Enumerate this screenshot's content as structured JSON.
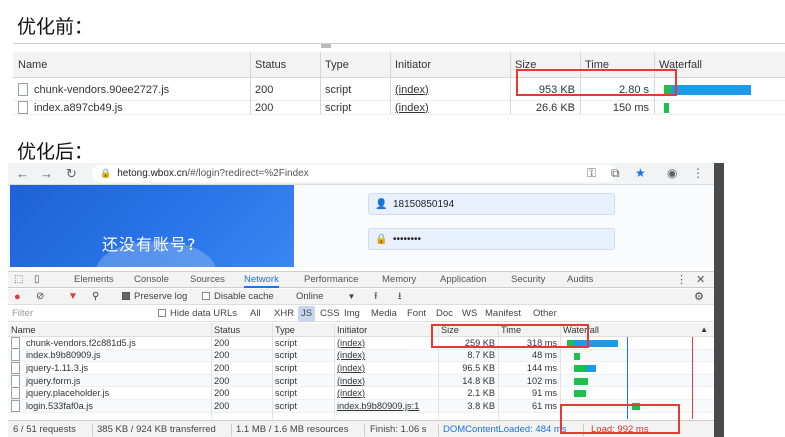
{
  "headings": {
    "before": "优化前：",
    "after": "优化后："
  },
  "before_table": {
    "columns": [
      "Name",
      "Status",
      "Type",
      "Initiator",
      "Size",
      "Time",
      "Waterfall"
    ],
    "rows": [
      {
        "name": "chunk-vendors.90ee2727.js",
        "status": "200",
        "type": "script",
        "initiator": "(index)",
        "size": "953 KB",
        "time": "2.80 s"
      },
      {
        "name": "index.a897cb49.js",
        "status": "200",
        "type": "script",
        "initiator": "(index)",
        "size": "26.6 KB",
        "time": "150 ms"
      }
    ],
    "colors": {
      "bar_blue": "#1e9be8",
      "bar_green": "#1cc04b",
      "highlight": "#e53935"
    }
  },
  "browser": {
    "address": {
      "host": "hetong.wbox.cn",
      "path": "/#/login?redirect=%2Findex"
    },
    "page": {
      "banner_text": "还没有账号?",
      "phone_value": "18150850194",
      "password_value": "••••••••",
      "banner_color": "#2a76ea"
    },
    "devtools": {
      "tabs": [
        "Elements",
        "Console",
        "Sources",
        "Network",
        "Performance",
        "Memory",
        "Application",
        "Security",
        "Audits"
      ],
      "active_tab": "Network",
      "toolbar": {
        "preserve_log": "Preserve log",
        "disable_cache": "Disable cache",
        "throttle": "Online"
      },
      "filter": {
        "placeholder": "Filter",
        "hide_data_urls": "Hide data URLs",
        "types": [
          "All",
          "XHR",
          "JS",
          "CSS",
          "Img",
          "Media",
          "Font",
          "Doc",
          "WS",
          "Manifest",
          "Other"
        ],
        "active_type": "JS"
      },
      "columns": [
        "Name",
        "Status",
        "Type",
        "Initiator",
        "Size",
        "Time",
        "Waterfall"
      ],
      "rows": [
        {
          "name": "chunk-vendors.f2c881d5.js",
          "status": "200",
          "type": "script",
          "initiator": "(index)",
          "size": "259 KB",
          "time": "318 ms"
        },
        {
          "name": "index.b9b80909.js",
          "status": "200",
          "type": "script",
          "initiator": "(index)",
          "size": "8.7 KB",
          "time": "48 ms"
        },
        {
          "name": "jquery-1.11.3.js",
          "status": "200",
          "type": "script",
          "initiator": "(index)",
          "size": "96.5 KB",
          "time": "144 ms"
        },
        {
          "name": "jquery.form.js",
          "status": "200",
          "type": "script",
          "initiator": "(index)",
          "size": "14.8 KB",
          "time": "102 ms"
        },
        {
          "name": "jquery.placeholder.js",
          "status": "200",
          "type": "script",
          "initiator": "(index)",
          "size": "2.1 KB",
          "time": "91 ms"
        },
        {
          "name": "login.533faf0a.js",
          "status": "200",
          "type": "script",
          "initiator": "index.b9b80909.js:1",
          "size": "3.8 KB",
          "time": "61 ms"
        }
      ],
      "status_bar": {
        "requests": "6 / 51 requests",
        "transferred": "385 KB / 924 KB transferred",
        "resources": "1.1 MB / 1.6 MB resources",
        "finish": "Finish: 1.06 s",
        "dom_loaded": "DOMContentLoaded: 484 ms",
        "load": "Load: 992 ms"
      },
      "colors": {
        "bar_blue": "#1e9be8",
        "bar_green": "#1cc04b",
        "dom_line": "#1a73e8",
        "load_line": "#e53935"
      }
    }
  }
}
